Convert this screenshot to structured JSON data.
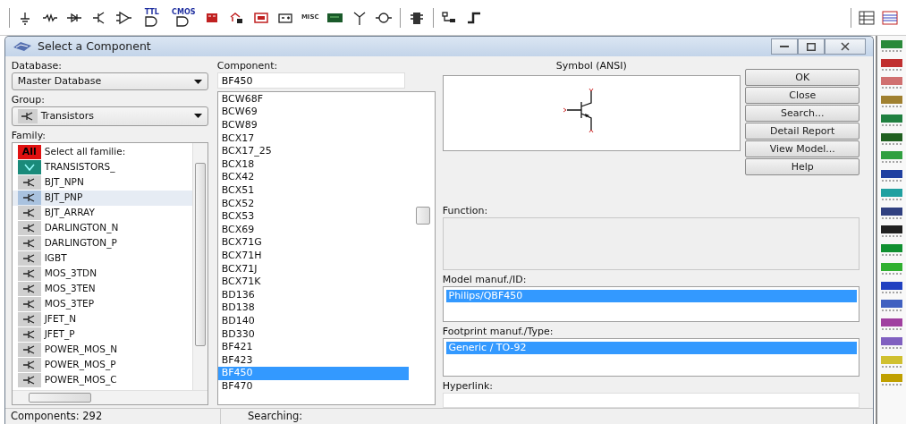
{
  "toolbar": [
    {
      "kind": "ground"
    },
    {
      "kind": "resistor"
    },
    {
      "kind": "diode"
    },
    {
      "kind": "transistor"
    },
    {
      "kind": "opamp"
    },
    {
      "kind": "gate",
      "text": "TTL"
    },
    {
      "kind": "gate",
      "text": "CMOS"
    },
    {
      "kind": "chip"
    },
    {
      "kind": "mixed"
    },
    {
      "kind": "indicator"
    },
    {
      "kind": "power"
    },
    {
      "kind": "text",
      "text": "MISC"
    },
    {
      "kind": "board"
    },
    {
      "kind": "antenna"
    },
    {
      "kind": "motor"
    },
    {
      "kind": "sep"
    },
    {
      "kind": "relay"
    },
    {
      "kind": "sep"
    },
    {
      "kind": "hier"
    },
    {
      "kind": "bus"
    }
  ],
  "toolbar_right": [
    {
      "kind": "grid"
    },
    {
      "kind": "lines"
    }
  ],
  "dialog": {
    "title": "Select a Component",
    "database": {
      "label": "Database:",
      "value": "Master Database"
    },
    "group": {
      "label": "Group:",
      "value": "Transistors"
    },
    "family": {
      "label": "Family:",
      "items": [
        {
          "label": "Select all familie:",
          "kind": "all",
          "badge": "All",
          "selected": false
        },
        {
          "label": "TRANSISTORS_",
          "kind": "virtual",
          "selected": false
        },
        {
          "label": "BJT_NPN",
          "kind": "symbol",
          "selected": false
        },
        {
          "label": "BJT_PNP",
          "kind": "symbol",
          "selected": true
        },
        {
          "label": "BJT_ARRAY",
          "kind": "symbol",
          "selected": false
        },
        {
          "label": "DARLINGTON_N",
          "kind": "symbol",
          "selected": false
        },
        {
          "label": "DARLINGTON_P",
          "kind": "symbol",
          "selected": false
        },
        {
          "label": "IGBT",
          "kind": "symbol",
          "selected": false
        },
        {
          "label": "MOS_3TDN",
          "kind": "symbol",
          "selected": false
        },
        {
          "label": "MOS_3TEN",
          "kind": "symbol",
          "selected": false
        },
        {
          "label": "MOS_3TEP",
          "kind": "symbol",
          "selected": false
        },
        {
          "label": "JFET_N",
          "kind": "symbol",
          "selected": false
        },
        {
          "label": "JFET_P",
          "kind": "symbol",
          "selected": false
        },
        {
          "label": "POWER_MOS_N",
          "kind": "symbol",
          "selected": false
        },
        {
          "label": "POWER_MOS_P",
          "kind": "symbol",
          "selected": false
        },
        {
          "label": "POWER_MOS_C",
          "kind": "symbol",
          "selected": false
        }
      ]
    },
    "component": {
      "label": "Component:",
      "value": "BF450",
      "items": [
        {
          "label": "BCW68F",
          "selected": false
        },
        {
          "label": "BCW69",
          "selected": false
        },
        {
          "label": "BCW89",
          "selected": false
        },
        {
          "label": "BCX17",
          "selected": false
        },
        {
          "label": "BCX17_25",
          "selected": false
        },
        {
          "label": "BCX18",
          "selected": false
        },
        {
          "label": "BCX42",
          "selected": false
        },
        {
          "label": "BCX51",
          "selected": false
        },
        {
          "label": "BCX52",
          "selected": false
        },
        {
          "label": "BCX53",
          "selected": false
        },
        {
          "label": "BCX69",
          "selected": false
        },
        {
          "label": "BCX71G",
          "selected": false
        },
        {
          "label": "BCX71H",
          "selected": false
        },
        {
          "label": "BCX71J",
          "selected": false
        },
        {
          "label": "BCX71K",
          "selected": false
        },
        {
          "label": "BD136",
          "selected": false
        },
        {
          "label": "BD138",
          "selected": false
        },
        {
          "label": "BD140",
          "selected": false
        },
        {
          "label": "BD330",
          "selected": false
        },
        {
          "label": "BF421",
          "selected": false
        },
        {
          "label": "BF423",
          "selected": false
        },
        {
          "label": "BF450",
          "selected": true
        },
        {
          "label": "BF470",
          "selected": false
        }
      ]
    },
    "symbol_label": "Symbol (ANSI)",
    "function_label": "Function:",
    "model": {
      "label": "Model manuf./ID:",
      "items": [
        {
          "label": "Philips/QBF450",
          "selected": true
        }
      ]
    },
    "footprint": {
      "label": "Footprint manuf./Type:",
      "items": [
        {
          "label": "Generic / TO-92",
          "selected": true
        }
      ]
    },
    "hyperlink": {
      "label": "Hyperlink:"
    },
    "buttons": [
      "OK",
      "Close",
      "Search...",
      "Detail Report",
      "View Model...",
      "Help"
    ],
    "status": [
      "Components: 292",
      "Searching:"
    ]
  },
  "instruments": [
    {
      "color": "#2a8a3a"
    },
    {
      "color": "#c03030"
    },
    {
      "color": "#d07070"
    },
    {
      "color": "#a08030"
    },
    {
      "color": "#208040"
    },
    {
      "color": "#206020"
    },
    {
      "color": "#30a040"
    },
    {
      "color": "#2040a0"
    },
    {
      "color": "#20a0a0"
    },
    {
      "color": "#304080"
    },
    {
      "color": "#202020"
    },
    {
      "color": "#109030"
    },
    {
      "color": "#30b030"
    },
    {
      "color": "#2040c0"
    },
    {
      "color": "#4060c0"
    },
    {
      "color": "#a040a0"
    },
    {
      "color": "#8060c0"
    },
    {
      "color": "#d0c030"
    },
    {
      "color": "#c0a000"
    }
  ]
}
